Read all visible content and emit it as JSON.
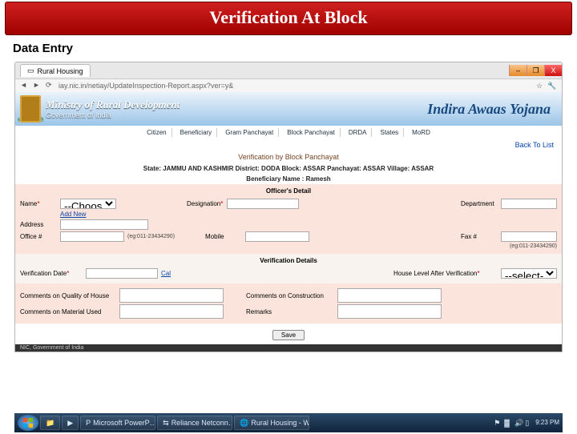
{
  "slide": {
    "title": "Verification At Block",
    "subtitle": "Data Entry"
  },
  "browser": {
    "tab_title": "Rural Housing",
    "url": "iay.nic.in/netiay/UpdateInspection-Report.aspx?ver=y&",
    "win": {
      "min": "–",
      "max": "❐",
      "close": "X"
    }
  },
  "banner": {
    "ministry": "Ministry of Rural Development",
    "gov": "Government of India",
    "brand": "Indira Awaas Yojana",
    "grass": "समाज शक्ति"
  },
  "nav": {
    "items": [
      "Citizen",
      "Beneficiary",
      "Gram Panchayat",
      "Block Panchayat",
      "DRDA",
      "States",
      "MoRD"
    ],
    "back": "Back To List"
  },
  "page": {
    "section_title": "Verification by Block Panchayat",
    "breadcrumb": "State: JAMMU AND KASHMIR District: DODA Block: ASSAR Panchayat: ASSAR Village: ASSAR",
    "beneficiary_name_lbl": "Beneficiary Name :",
    "beneficiary_name_val": "Ramesh"
  },
  "officer": {
    "head": "Officer's Detail",
    "name_lbl": "Name",
    "name_select": "--Choose--",
    "add_new": "Add New",
    "designation_lbl": "Designation",
    "department_lbl": "Department",
    "address_lbl": "Address",
    "office_lbl": "Office #",
    "office_hint": "(eg:011-23434290)",
    "mobile_lbl": "Mobile",
    "fax_lbl": "Fax #",
    "fax_hint": "(eg:011-23434290)"
  },
  "verification": {
    "head": "Verification Details",
    "date_lbl": "Verification Date",
    "cal": "Cal",
    "level_lbl": "House Level After Verification",
    "level_select": "--select--",
    "quality_lbl": "Comments on Quality of House",
    "construction_lbl": "Comments on Construction",
    "material_lbl": "Comments on Material Used",
    "remarks_lbl": "Remarks"
  },
  "buttons": {
    "save": "Save"
  },
  "footer": {
    "nic": "NIC, Government of India"
  },
  "taskbar": {
    "items": [
      "",
      "",
      "Microsoft PowerP…",
      "Reliance Netconn…",
      "Rural Housing - W…"
    ],
    "time": "9:23 PM"
  }
}
